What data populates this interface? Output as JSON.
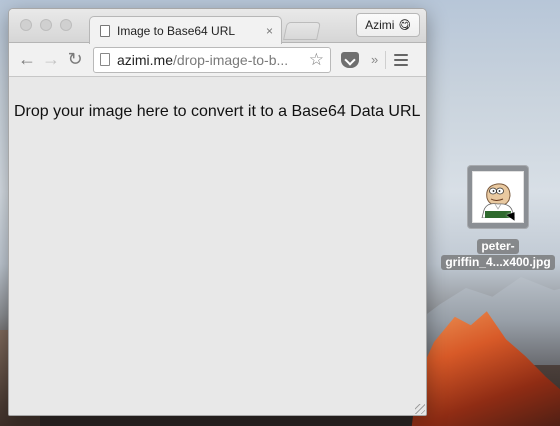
{
  "browser": {
    "tab": {
      "title": "Image to Base64 URL",
      "close_label": "×"
    },
    "profile": {
      "name": "Azimi",
      "emoji": "😋"
    },
    "toolbar": {
      "back": "←",
      "forward": "→",
      "reload": "↻",
      "url_domain": "azimi.me",
      "url_path": "/drop-image-to-b...",
      "star": "☆",
      "overflow": "»"
    }
  },
  "page": {
    "drop_text": "Drop your image here to convert it to a Base64 Data URL"
  },
  "desktop": {
    "file": {
      "name_line1": "peter-",
      "name_line2": "griffin_4...x400.jpg"
    }
  }
}
